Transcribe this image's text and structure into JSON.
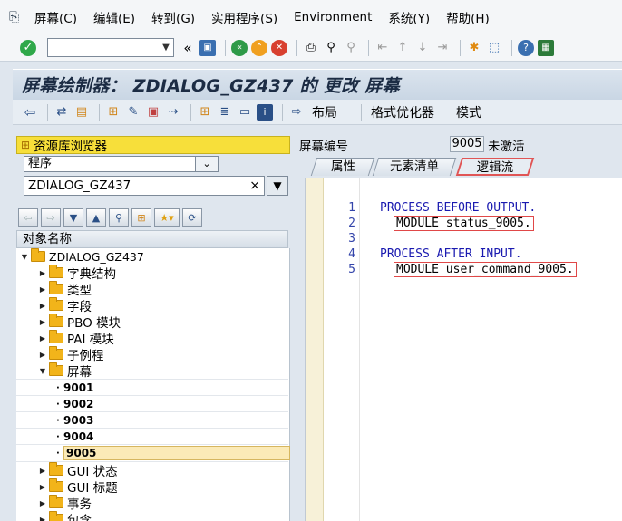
{
  "menu": {
    "items": [
      "屏幕(C)",
      "编辑(E)",
      "转到(G)",
      "实用程序(S)",
      "Environment",
      "系统(Y)",
      "帮助(H)"
    ]
  },
  "title": "屏幕绘制器： ZDIALOG_GZ437 的 更改 屏幕",
  "appbar": {
    "layout": "布局",
    "optimizer": "格式优化器",
    "mode": "模式"
  },
  "repo": {
    "header": "资源库浏览器",
    "object_type": "程序",
    "object_name": "ZDIALOG_GZ437",
    "column_header": "对象名称"
  },
  "tree": {
    "root": "ZDIALOG_GZ437",
    "folders_top": [
      "字典结构",
      "类型",
      "字段",
      "PBO 模块",
      "PAI 模块",
      "子例程"
    ],
    "screens_folder": "屏幕",
    "screens": [
      "9001",
      "9002",
      "9003",
      "9004",
      "9005"
    ],
    "folders_bottom": [
      "GUI 状态",
      "GUI 标题",
      "事务",
      "包含"
    ]
  },
  "screen": {
    "label": "屏幕编号",
    "number": "9005",
    "status": "未激活"
  },
  "tabs": [
    "属性",
    "元素清单",
    "逻辑流"
  ],
  "editor": {
    "lines": [
      "1",
      "2",
      "3",
      "4",
      "5"
    ],
    "pbo": "PROCESS BEFORE OUTPUT.",
    "module1": "MODULE status_9005.",
    "pai": "PROCESS AFTER INPUT.",
    "module2": "MODULE user_command_9005."
  }
}
